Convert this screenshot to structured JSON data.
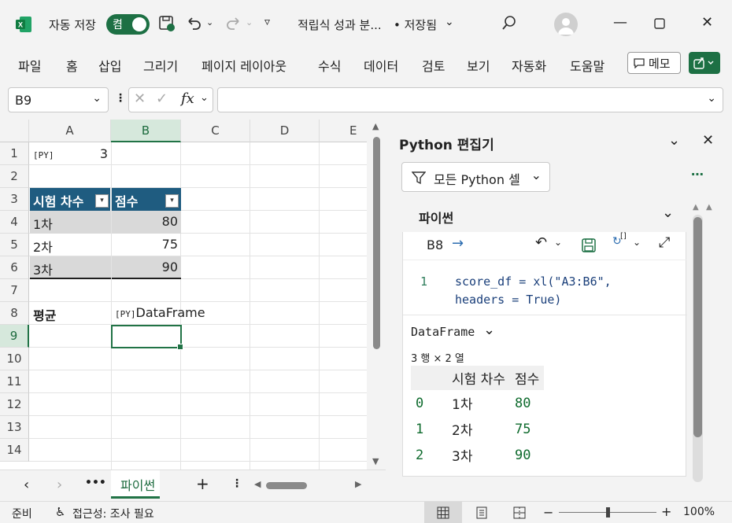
{
  "titlebar": {
    "autosave_label": "자동 저장",
    "autosave_state": "켬",
    "doc_title": "적립식 성과 분...",
    "doc_status": "• 저장됨",
    "accent": "#1d7044"
  },
  "ribbon": {
    "tabs": [
      "파일",
      "홈",
      "삽입",
      "그리기",
      "페이지 레이아웃",
      "수식",
      "데이터",
      "검토",
      "보기",
      "자동화",
      "도움말"
    ],
    "memo_label": "메모"
  },
  "formula_bar": {
    "name_box": "B9",
    "fx_label": "fx",
    "formula": ""
  },
  "sheet": {
    "columns": [
      "A",
      "B",
      "C",
      "D",
      "E"
    ],
    "rows": [
      "1",
      "2",
      "3",
      "4",
      "5",
      "6",
      "7",
      "8",
      "9",
      "10",
      "11",
      "12",
      "13",
      "14"
    ],
    "a1_badge": "[PY]",
    "a1_value": "3",
    "table_header": [
      "시험 차수",
      "점수"
    ],
    "table_rows": [
      [
        "1차",
        "80"
      ],
      [
        "2차",
        "75"
      ],
      [
        "3차",
        "90"
      ]
    ],
    "a8_label": "평균",
    "b8_badge": "[PY]",
    "b8_value": "DataFrame"
  },
  "sheet_tabs": {
    "active": "파이썬"
  },
  "status_bar": {
    "ready": "준비",
    "accessibility": "접근성: 조사 필요",
    "zoom": "100%"
  },
  "python_editor": {
    "title": "Python 편집기",
    "filter_label": "모든 Python 셀",
    "section": "파이썬",
    "cell_ref": "B8",
    "line_number": "1",
    "code_line1": "score_df = xl(\"A3:B6\",",
    "code_line2": "headers = True)",
    "output_type": "DataFrame",
    "shape": "3 행 × 2 열",
    "df_columns": [
      "시험 차수",
      "점수"
    ],
    "df_rows": [
      {
        "index": "0",
        "col1": "1차",
        "col2": "80"
      },
      {
        "index": "1",
        "col1": "2차",
        "col2": "75"
      },
      {
        "index": "2",
        "col1": "3차",
        "col2": "90"
      }
    ]
  }
}
